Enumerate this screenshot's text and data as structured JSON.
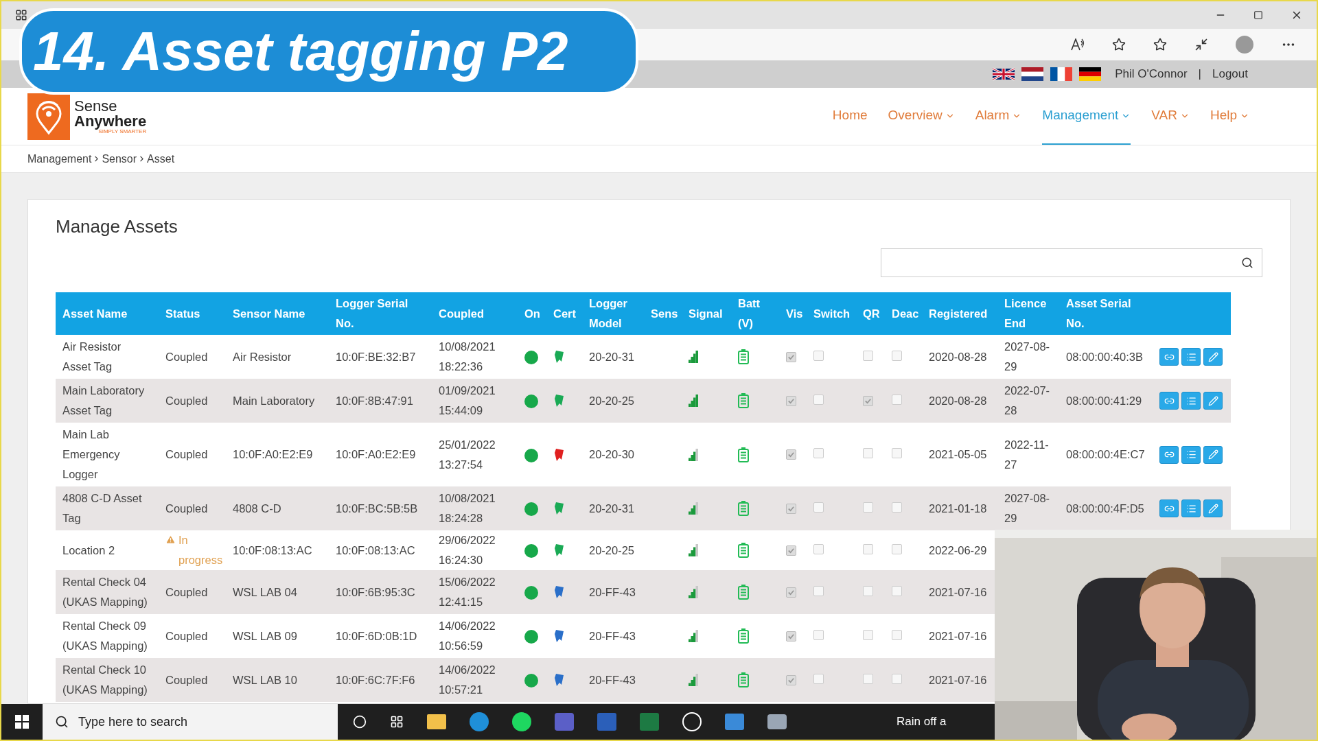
{
  "overlay_title": "14. Asset tagging P2",
  "site_header": {
    "user": "Phil O'Connor",
    "separator": "|",
    "logout": "Logout"
  },
  "logo": {
    "line_1": "Sense",
    "line_2": "Anywhere",
    "tagline": "SIMPLY SMARTER"
  },
  "nav": [
    {
      "label": "Home",
      "selected": false,
      "dropdown": false
    },
    {
      "label": "Overview",
      "selected": false,
      "dropdown": true
    },
    {
      "label": "Alarm",
      "selected": false,
      "dropdown": true
    },
    {
      "label": "Management",
      "selected": true,
      "dropdown": true
    },
    {
      "label": "VAR",
      "selected": false,
      "dropdown": true
    },
    {
      "label": "Help",
      "selected": false,
      "dropdown": true
    }
  ],
  "breadcrumb": [
    "Management",
    "Sensor",
    "Asset"
  ],
  "page_title": "Manage Assets",
  "table": {
    "columns": [
      "Asset Name",
      "Status",
      "Sensor Name",
      "Logger Serial No.",
      "Coupled",
      "On",
      "Cert",
      "Logger Model",
      "Sens",
      "Signal",
      "Batt (V)",
      "Vis",
      "Switch",
      "QR",
      "Deac",
      "Registered",
      "Licence End",
      "Asset Serial No."
    ],
    "rows": [
      {
        "asset_name": "Air Resistor Asset Tag",
        "status": "Coupled",
        "warning": false,
        "sensor_name": "Air Resistor",
        "logger_serial": "10:0F:BE:32:B7",
        "coupled": "10/08/2021 18:22:36",
        "color": "#1aaa55",
        "logger_model": "20-20-31",
        "signal_full": true,
        "vis": true,
        "switch": false,
        "qr": false,
        "deac": false,
        "registered": "2020-08-28",
        "licence_end": "2027-08-29",
        "asset_serial": "08:00:00:40:3B"
      },
      {
        "asset_name": "Main Laboratory Asset Tag",
        "status": "Coupled",
        "warning": false,
        "sensor_name": "Main Laboratory",
        "logger_serial": "10:0F:8B:47:91",
        "coupled": "01/09/2021 15:44:09",
        "color": "#1aaa55",
        "logger_model": "20-20-25",
        "signal_full": true,
        "vis": true,
        "switch": false,
        "qr": true,
        "deac": false,
        "registered": "2020-08-28",
        "licence_end": "2022-07-28",
        "asset_serial": "08:00:00:41:29"
      },
      {
        "asset_name": "Main Lab Emergency Logger",
        "status": "Coupled",
        "warning": false,
        "sensor_name": "10:0F:A0:E2:E9",
        "logger_serial": "10:0F:A0:E2:E9",
        "coupled": "25/01/2022 13:27:54",
        "color": "#e02020",
        "logger_model": "20-20-30",
        "signal_full": false,
        "vis": true,
        "switch": false,
        "qr": false,
        "deac": false,
        "registered": "2021-05-05",
        "licence_end": "2022-11-27",
        "asset_serial": "08:00:00:4E:C7"
      },
      {
        "asset_name": "4808 C-D Asset Tag",
        "status": "Coupled",
        "warning": false,
        "sensor_name": "4808 C-D",
        "logger_serial": "10:0F:BC:5B:5B",
        "coupled": "10/08/2021 18:24:28",
        "color": "#1aaa55",
        "logger_model": "20-20-31",
        "signal_full": false,
        "vis": true,
        "switch": false,
        "qr": false,
        "deac": false,
        "registered": "2021-01-18",
        "licence_end": "2027-08-29",
        "asset_serial": "08:00:00:4F:D5"
      },
      {
        "asset_name": "Location 2",
        "status": "In progress",
        "warning": true,
        "sensor_name": "10:0F:08:13:AC",
        "logger_serial": "10:0F:08:13:AC",
        "coupled": "29/06/2022 16:24:30",
        "color": "#1aaa55",
        "logger_model": "20-20-25",
        "signal_full": false,
        "vis": true,
        "switch": false,
        "qr": false,
        "deac": false,
        "registered": "2022-06-29"
      },
      {
        "asset_name": "Rental Check 04 (UKAS Mapping)",
        "status": "Coupled",
        "warning": false,
        "sensor_name": "WSL LAB 04",
        "logger_serial": "10:0F:6B:95:3C",
        "coupled": "15/06/2022 12:41:15",
        "color": "#2a6fc9",
        "logger_model": "20-FF-43",
        "signal_full": false,
        "vis": true,
        "switch": false,
        "qr": false,
        "deac": false,
        "registered": "2021-07-16"
      },
      {
        "asset_name": "Rental Check 09 (UKAS Mapping)",
        "status": "Coupled",
        "warning": false,
        "sensor_name": "WSL LAB 09",
        "logger_serial": "10:0F:6D:0B:1D",
        "coupled": "14/06/2022 10:56:59",
        "color": "#2a6fc9",
        "logger_model": "20-FF-43",
        "signal_full": false,
        "vis": true,
        "switch": false,
        "qr": false,
        "deac": false,
        "registered": "2021-07-16"
      },
      {
        "asset_name": "Rental Check 10 (UKAS Mapping)",
        "status": "Coupled",
        "warning": false,
        "sensor_name": "WSL LAB 10",
        "logger_serial": "10:0F:6C:7F:F6",
        "coupled": "14/06/2022 10:57:21",
        "color": "#2a6fc9",
        "logger_model": "20-FF-43",
        "signal_full": false,
        "vis": true,
        "switch": false,
        "qr": false,
        "deac": false,
        "registered": "2021-07-16"
      }
    ]
  },
  "taskbar": {
    "search_placeholder": "Type here to search",
    "weather": "Rain off a"
  }
}
